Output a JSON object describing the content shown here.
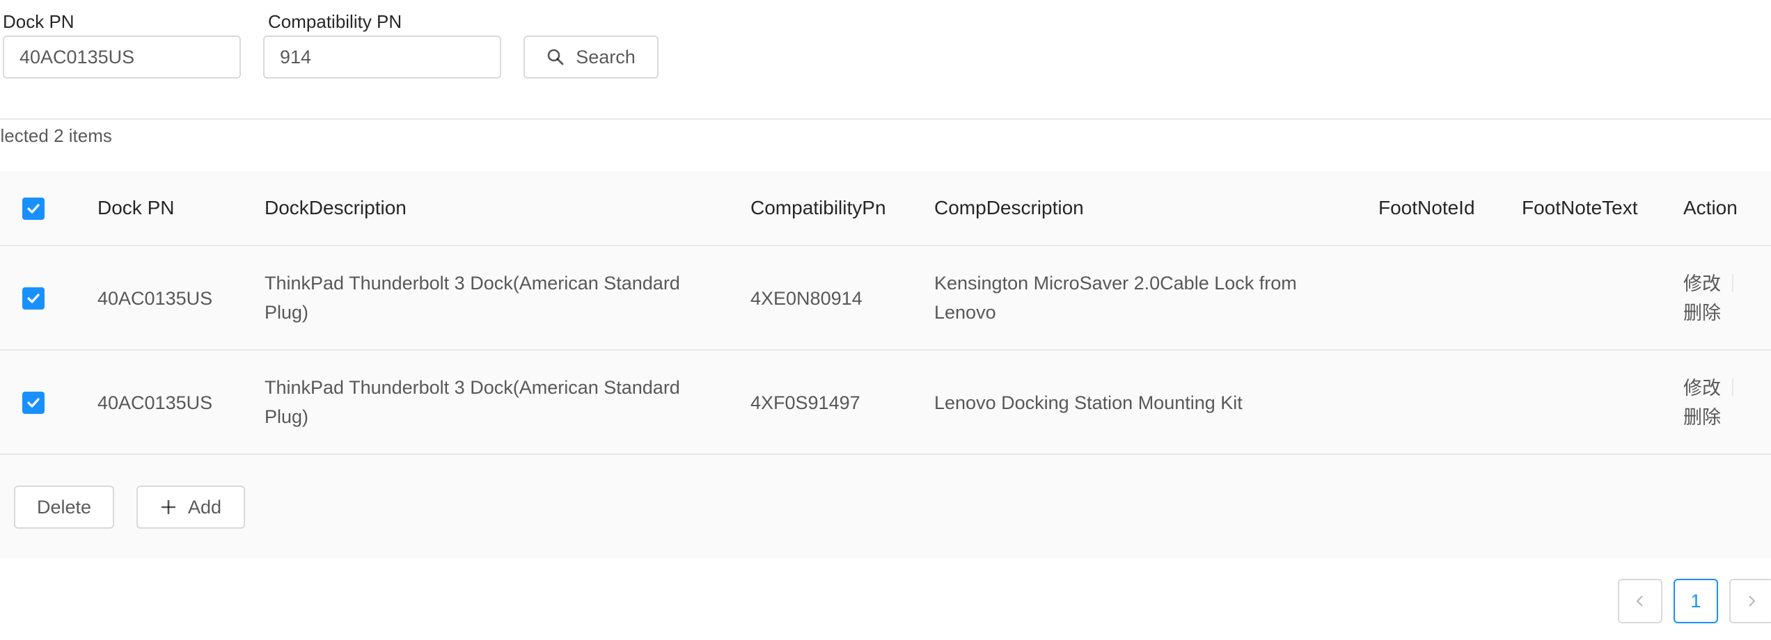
{
  "search": {
    "dock_pn_label": "Dock PN",
    "dock_pn_value": "40AC0135US",
    "compat_pn_label": "Compatibility PN",
    "compat_pn_value": "914",
    "search_button": "Search"
  },
  "selection": {
    "text": "elected 2 items"
  },
  "table": {
    "headers": {
      "dock_pn": "Dock PN",
      "dock_description": "DockDescription",
      "compatibility_pn": "CompatibilityPn",
      "comp_description": "CompDescription",
      "footnote_id": "FootNoteId",
      "footnote_text": "FootNoteText",
      "action": "Action"
    },
    "rows": [
      {
        "dock_pn": "40AC0135US",
        "dock_description": "ThinkPad Thunderbolt 3 Dock(American Standard Plug)",
        "compatibility_pn": "4XE0N80914",
        "comp_description": "Kensington MicroSaver 2.0Cable Lock from Lenovo",
        "footnote_id": "",
        "footnote_text": "",
        "edit": "修改",
        "delete": "删除",
        "checked": true
      },
      {
        "dock_pn": "40AC0135US",
        "dock_description": "ThinkPad Thunderbolt 3 Dock(American Standard Plug)",
        "compatibility_pn": "4XF0S91497",
        "comp_description": "Lenovo Docking Station Mounting Kit",
        "footnote_id": "",
        "footnote_text": "",
        "edit": "修改",
        "delete": "删除",
        "checked": true
      }
    ]
  },
  "footer": {
    "delete_button": "Delete",
    "add_button": "Add"
  },
  "pagination": {
    "current_page": "1",
    "prev_icon": "chevron-left-icon",
    "next_icon": "chevron-right-icon"
  },
  "colors": {
    "primary": "#1890ff",
    "border": "#d9d9d9",
    "row_bg": "#fafafa"
  }
}
